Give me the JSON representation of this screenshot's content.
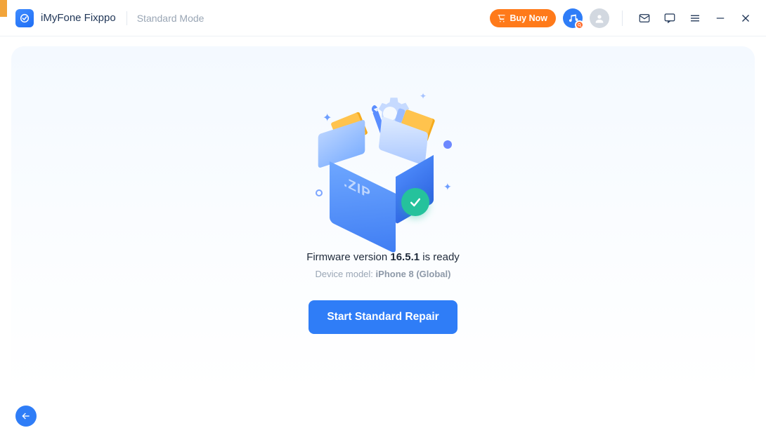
{
  "app": {
    "name": "iMyFone Fixppo",
    "mode": "Standard Mode"
  },
  "titlebar": {
    "buy_now": "Buy Now"
  },
  "main": {
    "zip_label": ".ZIP",
    "firmware_prefix": "Firmware version ",
    "firmware_version": "16.5.1",
    "firmware_suffix": " is ready",
    "device_label": "Device model: ",
    "device_model": "iPhone 8 (Global)",
    "start_button": "Start Standard Repair"
  }
}
